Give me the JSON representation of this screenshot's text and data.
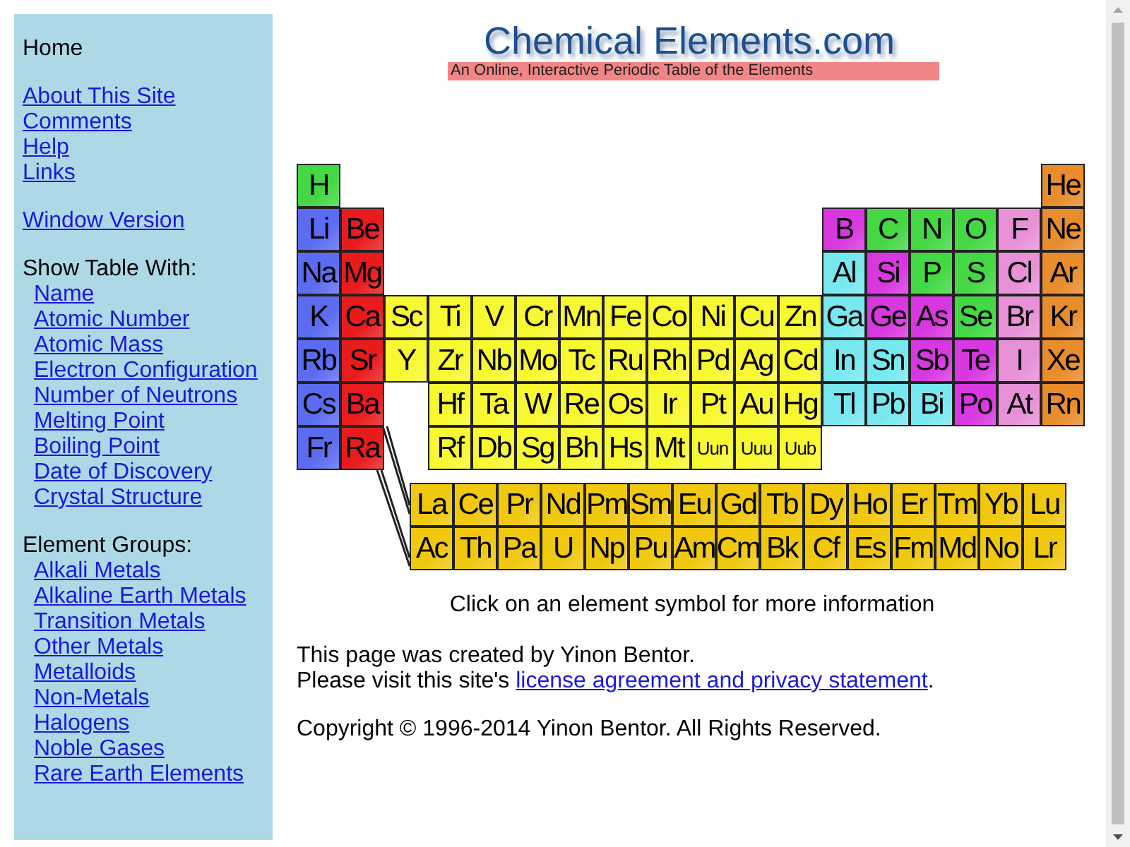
{
  "sidebar": {
    "home": "Home",
    "links": [
      "About This Site",
      "Comments",
      "Help",
      "Links"
    ],
    "window_link": "Window Version",
    "show_heading": "Show Table With:",
    "show_links": [
      "Name",
      "Atomic Number",
      "Atomic Mass",
      "Electron Configuration",
      "Number of Neutrons",
      "Melting Point",
      "Boiling Point",
      "Date of Discovery",
      "Crystal Structure"
    ],
    "groups_heading": "Element Groups:",
    "group_links": [
      "Alkali Metals",
      "Alkaline Earth Metals",
      "Transition Metals",
      "Other Metals",
      "Metalloids",
      "Non-Metals",
      "Halogens",
      "Noble Gases",
      "Rare Earth Elements"
    ]
  },
  "header": {
    "title": "Chemical Elements.com",
    "subtitle": "An Online, Interactive Periodic Table of the Elements"
  },
  "table": {
    "rows": [
      {
        "cells": [
          {
            "symbol": "H",
            "color": "#44d844"
          },
          "",
          "",
          "",
          "",
          "",
          "",
          "",
          "",
          "",
          "",
          "",
          "",
          "",
          "",
          "",
          "",
          {
            "symbol": "He",
            "color": "#e88c2c"
          }
        ]
      },
      {
        "cells": [
          {
            "symbol": "Li",
            "color": "#5c6cf0"
          },
          {
            "symbol": "Be",
            "color": "#e81c1c"
          },
          "",
          "",
          "",
          "",
          "",
          "",
          "",
          "",
          "",
          "",
          {
            "symbol": "B",
            "color": "#d838e0"
          },
          {
            "symbol": "C",
            "color": "#44d844"
          },
          {
            "symbol": "N",
            "color": "#44d844"
          },
          {
            "symbol": "O",
            "color": "#44d844"
          },
          {
            "symbol": "F",
            "color": "#e890d8"
          },
          {
            "symbol": "Ne",
            "color": "#e88c2c"
          }
        ]
      },
      {
        "cells": [
          {
            "symbol": "Na",
            "color": "#5c6cf0"
          },
          {
            "symbol": "Mg",
            "color": "#e81c1c"
          },
          "",
          "",
          "",
          "",
          "",
          "",
          "",
          "",
          "",
          "",
          {
            "symbol": "Al",
            "color": "#78e8f0"
          },
          {
            "symbol": "Si",
            "color": "#d838e0"
          },
          {
            "symbol": "P",
            "color": "#44d844"
          },
          {
            "symbol": "S",
            "color": "#44d844"
          },
          {
            "symbol": "Cl",
            "color": "#e890d8"
          },
          {
            "symbol": "Ar",
            "color": "#e88c2c"
          }
        ]
      },
      {
        "cells": [
          {
            "symbol": "K",
            "color": "#5c6cf0"
          },
          {
            "symbol": "Ca",
            "color": "#e81c1c"
          },
          {
            "symbol": "Sc",
            "color": "#f8f832"
          },
          {
            "symbol": "Ti",
            "color": "#f8f832"
          },
          {
            "symbol": "V",
            "color": "#f8f832"
          },
          {
            "symbol": "Cr",
            "color": "#f8f832"
          },
          {
            "symbol": "Mn",
            "color": "#f8f832"
          },
          {
            "symbol": "Fe",
            "color": "#f8f832"
          },
          {
            "symbol": "Co",
            "color": "#f8f832"
          },
          {
            "symbol": "Ni",
            "color": "#f8f832"
          },
          {
            "symbol": "Cu",
            "color": "#f8f832"
          },
          {
            "symbol": "Zn",
            "color": "#f8f832"
          },
          {
            "symbol": "Ga",
            "color": "#78e8f0"
          },
          {
            "symbol": "Ge",
            "color": "#d838e0"
          },
          {
            "symbol": "As",
            "color": "#d838e0"
          },
          {
            "symbol": "Se",
            "color": "#44d844"
          },
          {
            "symbol": "Br",
            "color": "#e890d8"
          },
          {
            "symbol": "Kr",
            "color": "#e88c2c"
          }
        ]
      },
      {
        "cells": [
          {
            "symbol": "Rb",
            "color": "#5c6cf0"
          },
          {
            "symbol": "Sr",
            "color": "#e81c1c"
          },
          {
            "symbol": "Y",
            "color": "#f8f832"
          },
          {
            "symbol": "Zr",
            "color": "#f8f832"
          },
          {
            "symbol": "Nb",
            "color": "#f8f832"
          },
          {
            "symbol": "Mo",
            "color": "#f8f832"
          },
          {
            "symbol": "Tc",
            "color": "#f8f832"
          },
          {
            "symbol": "Ru",
            "color": "#f8f832"
          },
          {
            "symbol": "Rh",
            "color": "#f8f832"
          },
          {
            "symbol": "Pd",
            "color": "#f8f832"
          },
          {
            "symbol": "Ag",
            "color": "#f8f832"
          },
          {
            "symbol": "Cd",
            "color": "#f8f832"
          },
          {
            "symbol": "In",
            "color": "#78e8f0"
          },
          {
            "symbol": "Sn",
            "color": "#78e8f0"
          },
          {
            "symbol": "Sb",
            "color": "#d838e0"
          },
          {
            "symbol": "Te",
            "color": "#d838e0"
          },
          {
            "symbol": "I",
            "color": "#e890d8"
          },
          {
            "symbol": "Xe",
            "color": "#e88c2c"
          }
        ]
      },
      {
        "cells": [
          {
            "symbol": "Cs",
            "color": "#5c6cf0"
          },
          {
            "symbol": "Ba",
            "color": "#e81c1c"
          },
          "",
          {
            "symbol": "Hf",
            "color": "#f8f832"
          },
          {
            "symbol": "Ta",
            "color": "#f8f832"
          },
          {
            "symbol": "W",
            "color": "#f8f832"
          },
          {
            "symbol": "Re",
            "color": "#f8f832"
          },
          {
            "symbol": "Os",
            "color": "#f8f832"
          },
          {
            "symbol": "Ir",
            "color": "#f8f832"
          },
          {
            "symbol": "Pt",
            "color": "#f8f832"
          },
          {
            "symbol": "Au",
            "color": "#f8f832"
          },
          {
            "symbol": "Hg",
            "color": "#f8f832"
          },
          {
            "symbol": "Tl",
            "color": "#78e8f0"
          },
          {
            "symbol": "Pb",
            "color": "#78e8f0"
          },
          {
            "symbol": "Bi",
            "color": "#78e8f0"
          },
          {
            "symbol": "Po",
            "color": "#d838e0"
          },
          {
            "symbol": "At",
            "color": "#e890d8"
          },
          {
            "symbol": "Rn",
            "color": "#e88c2c"
          }
        ]
      },
      {
        "cells": [
          {
            "symbol": "Fr",
            "color": "#5c6cf0"
          },
          {
            "symbol": "Ra",
            "color": "#e81c1c"
          },
          "",
          {
            "symbol": "Rf",
            "color": "#f8f832"
          },
          {
            "symbol": "Db",
            "color": "#f8f832"
          },
          {
            "symbol": "Sg",
            "color": "#f8f832"
          },
          {
            "symbol": "Bh",
            "color": "#f8f832"
          },
          {
            "symbol": "Hs",
            "color": "#f8f832"
          },
          {
            "symbol": "Mt",
            "color": "#f8f832"
          },
          {
            "symbol": "Uun",
            "color": "#f8f832"
          },
          {
            "symbol": "Uuu",
            "color": "#f8f832"
          },
          {
            "symbol": "Uub",
            "color": "#f8f832"
          }
        ]
      }
    ],
    "rare_earth_rows": [
      {
        "cells": [
          {
            "symbol": "La",
            "color": "#f0c810"
          },
          {
            "symbol": "Ce",
            "color": "#f0c810"
          },
          {
            "symbol": "Pr",
            "color": "#f0c810"
          },
          {
            "symbol": "Nd",
            "color": "#f0c810"
          },
          {
            "symbol": "Pm",
            "color": "#f0c810"
          },
          {
            "symbol": "Sm",
            "color": "#f0c810"
          },
          {
            "symbol": "Eu",
            "color": "#f0c810"
          },
          {
            "symbol": "Gd",
            "color": "#f0c810"
          },
          {
            "symbol": "Tb",
            "color": "#f0c810"
          },
          {
            "symbol": "Dy",
            "color": "#f0c810"
          },
          {
            "symbol": "Ho",
            "color": "#f0c810"
          },
          {
            "symbol": "Er",
            "color": "#f0c810"
          },
          {
            "symbol": "Tm",
            "color": "#f0c810"
          },
          {
            "symbol": "Yb",
            "color": "#f0c810"
          },
          {
            "symbol": "Lu",
            "color": "#f0c810"
          }
        ]
      },
      {
        "cells": [
          {
            "symbol": "Ac",
            "color": "#f0c810"
          },
          {
            "symbol": "Th",
            "color": "#f0c810"
          },
          {
            "symbol": "Pa",
            "color": "#f0c810"
          },
          {
            "symbol": "U",
            "color": "#f0c810"
          },
          {
            "symbol": "Np",
            "color": "#f0c810"
          },
          {
            "symbol": "Pu",
            "color": "#f0c810"
          },
          {
            "symbol": "Am",
            "color": "#f0c810"
          },
          {
            "symbol": "Cm",
            "color": "#f0c810"
          },
          {
            "symbol": "Bk",
            "color": "#f0c810"
          },
          {
            "symbol": "Cf",
            "color": "#f0c810"
          },
          {
            "symbol": "Es",
            "color": "#f0c810"
          },
          {
            "symbol": "Fm",
            "color": "#f0c810"
          },
          {
            "symbol": "Md",
            "color": "#f0c810"
          },
          {
            "symbol": "No",
            "color": "#f0c810"
          },
          {
            "symbol": "Lr",
            "color": "#f0c810"
          }
        ]
      }
    ]
  },
  "instruction": "Click on an element symbol for more information",
  "credit": {
    "line_1": "This page was created by Yinon Bentor.",
    "line_2_prefix": "Please visit this site's ",
    "link": "license agreement and privacy statement",
    "line_2_suffix": "."
  },
  "copyright": "Copyright © 1996-2014 Yinon Bentor. All Rights Reserved."
}
